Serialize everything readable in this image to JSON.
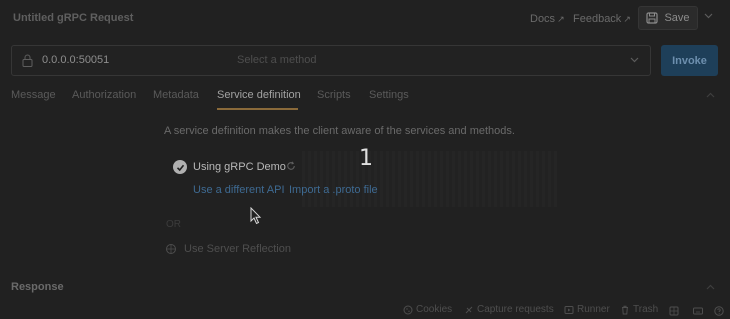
{
  "header": {
    "title": "Untitled gRPC Request",
    "docs_label": "Docs",
    "feedback_label": "Feedback",
    "save_label": "Save",
    "external_arrow": "↗"
  },
  "url_bar": {
    "url": "0.0.0.0:50051",
    "method_placeholder": "Select a method",
    "invoke_label": "Invoke"
  },
  "tabs": [
    {
      "label": "Message",
      "active": false
    },
    {
      "label": "Authorization",
      "active": false
    },
    {
      "label": "Metadata",
      "active": false
    },
    {
      "label": "Service definition",
      "active": true
    },
    {
      "label": "Scripts",
      "active": false
    },
    {
      "label": "Settings",
      "active": false
    }
  ],
  "service_definition": {
    "description": "A service definition makes the client aware of the services and methods.",
    "step_number": "1",
    "using_label": "Using gRPC Demo",
    "use_different_api": "Use a different API",
    "import_proto": "Import a .proto file",
    "or_label": "OR",
    "server_reflection": "Use Server Reflection"
  },
  "response": {
    "label": "Response"
  },
  "footer": {
    "cookies": "Cookies",
    "capture": "Capture requests",
    "runner": "Runner",
    "trash": "Trash"
  },
  "icons": {
    "lock": "lock-icon",
    "check": "check-circle-icon",
    "refresh": "refresh-icon",
    "server": "server-icon",
    "save": "save-icon"
  },
  "colors": {
    "background": "#212121",
    "accent_underline": "#8a6a3a",
    "invoke_bg": "#1e3f59",
    "link": "#3e6a92"
  }
}
